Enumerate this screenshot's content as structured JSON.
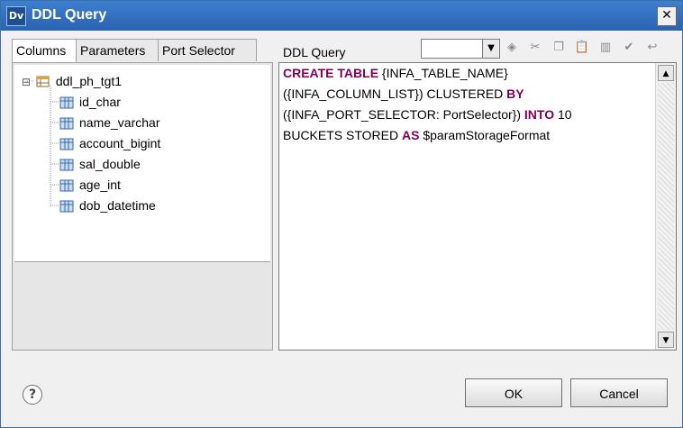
{
  "window": {
    "title": "DDL Query",
    "icon_text": "Dv",
    "close_label": "✕"
  },
  "tabs": [
    "Columns",
    "Parameters",
    "Port Selector"
  ],
  "tree": {
    "root": "ddl_ph_tgt1",
    "columns": [
      "id_char",
      "name_varchar",
      "account_bigint",
      "sal_double",
      "age_int",
      "dob_datetime"
    ],
    "expander": "⊟"
  },
  "ddl": {
    "label": "DDL Query",
    "dropdown_value": "",
    "toolbar_icons": [
      "add-icon",
      "cut-icon",
      "copy-icon",
      "paste-icon",
      "delete-icon",
      "validate-icon",
      "undo-icon"
    ],
    "code": {
      "line1_kw": "CREATE TABLE",
      "line1_text": " {INFA_TABLE_NAME}",
      "line2_text": "({INFA_COLUMN_LIST}) CLUSTERED ",
      "line2_kw": "BY",
      "line3_text": "({INFA_PORT_SELECTOR: PortSelector}) ",
      "line3_kw": "INTO",
      "line3_text2": " 10",
      "line4_text": "BUCKETS STORED ",
      "line4_kw": "AS",
      "line4_text2": " $paramStorageFormat"
    }
  },
  "buttons": {
    "help": "?",
    "ok": "OK",
    "cancel": "Cancel"
  },
  "colors": {
    "titlebar": "#2f6bbf",
    "keyword": "#7f0055"
  }
}
